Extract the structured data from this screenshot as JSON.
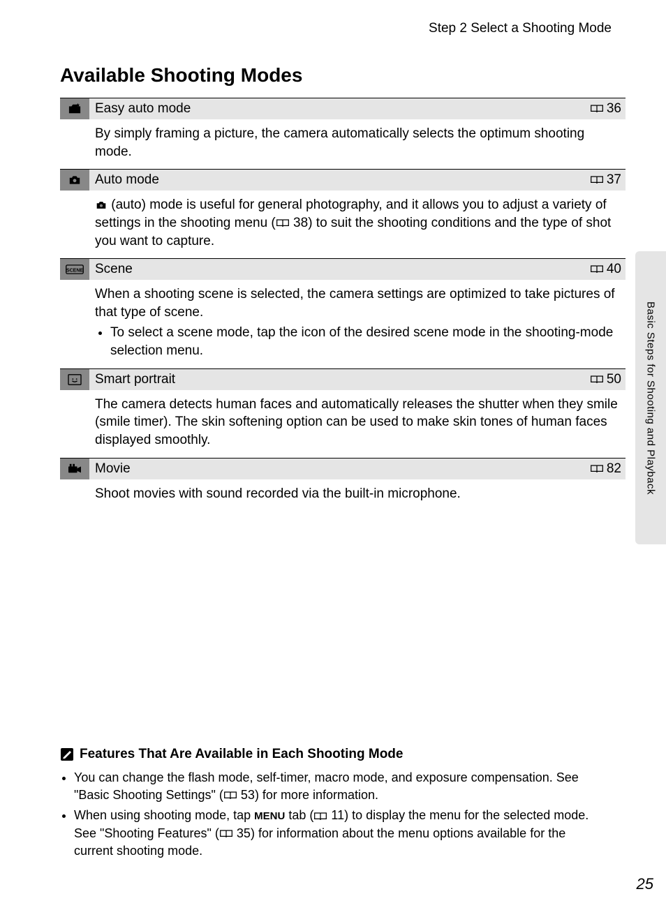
{
  "header": {
    "step": "Step 2 Select a Shooting Mode"
  },
  "section_title": "Available Shooting Modes",
  "modes": [
    {
      "icon": "easy-auto",
      "label": "Easy auto mode",
      "page": "36",
      "desc": "By simply framing a picture, the camera automatically selects the optimum shooting mode."
    },
    {
      "icon": "auto",
      "label": "Auto mode",
      "page": "37",
      "desc_pre": " (auto) mode is useful for general photography, and it allows you to adjust a variety of settings in the shooting menu (",
      "desc_mid_page": "38",
      "desc_post": ") to suit the shooting conditions and the type of shot you want to capture."
    },
    {
      "icon": "scene",
      "label": "Scene",
      "page": "40",
      "desc": "When a shooting scene is selected, the camera settings are optimized to take pictures of that type of scene.",
      "bullet": "To select a scene mode, tap the icon of the desired scene mode in the shooting-mode selection menu."
    },
    {
      "icon": "smart-portrait",
      "label": "Smart portrait",
      "page": "50",
      "desc": "The camera detects human faces and automatically releases the shutter when they smile (smile timer). The skin softening option can be used to make skin tones of human faces displayed smoothly."
    },
    {
      "icon": "movie",
      "label": "Movie",
      "page": "82",
      "desc": "Shoot movies with sound recorded via the built-in microphone."
    }
  ],
  "side_tab": "Basic Steps for Shooting and Playback",
  "features": {
    "heading": "Features That Are Available in Each Shooting Mode",
    "item1_pre": "You can change the flash mode, self-timer, macro mode, and exposure compensation. See \"Basic Shooting Settings\" (",
    "item1_page": "53",
    "item1_post": ") for more information.",
    "item2_pre": "When using shooting mode, tap ",
    "item2_menu": "MENU",
    "item2_mid1": " tab (",
    "item2_page1": "11",
    "item2_mid2": ") to display the menu for the selected mode. See \"Shooting Features\" (",
    "item2_page2": "35",
    "item2_post": ") for information about the menu options available for the current shooting mode."
  },
  "page_number": "25"
}
